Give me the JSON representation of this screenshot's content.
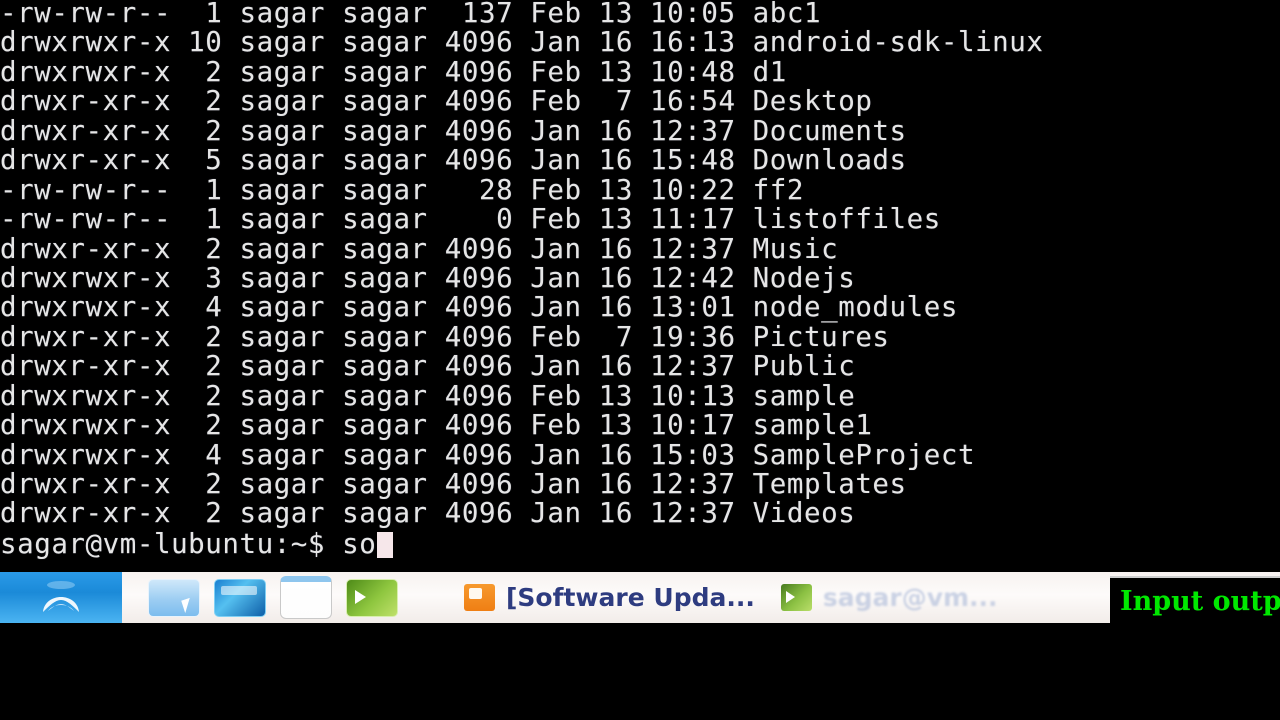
{
  "terminal": {
    "lines": [
      "-rw-rw-r--  1 sagar sagar  137 Feb 13 10:05 abc1",
      "drwxrwxr-x 10 sagar sagar 4096 Jan 16 16:13 android-sdk-linux",
      "drwxrwxr-x  2 sagar sagar 4096 Feb 13 10:48 d1",
      "drwxr-xr-x  2 sagar sagar 4096 Feb  7 16:54 Desktop",
      "drwxr-xr-x  2 sagar sagar 4096 Jan 16 12:37 Documents",
      "drwxr-xr-x  5 sagar sagar 4096 Jan 16 15:48 Downloads",
      "-rw-rw-r--  1 sagar sagar   28 Feb 13 10:22 ff2",
      "-rw-rw-r--  1 sagar sagar    0 Feb 13 11:17 listoffiles",
      "drwxr-xr-x  2 sagar sagar 4096 Jan 16 12:37 Music",
      "drwxrwxr-x  3 sagar sagar 4096 Jan 16 12:42 Nodejs",
      "drwxrwxr-x  4 sagar sagar 4096 Jan 16 13:01 node_modules",
      "drwxr-xr-x  2 sagar sagar 4096 Feb  7 19:36 Pictures",
      "drwxr-xr-x  2 sagar sagar 4096 Jan 16 12:37 Public",
      "drwxrwxr-x  2 sagar sagar 4096 Feb 13 10:13 sample",
      "drwxrwxr-x  2 sagar sagar 4096 Feb 13 10:17 sample1",
      "drwxrwxr-x  4 sagar sagar 4096 Jan 16 15:03 SampleProject",
      "drwxr-xr-x  2 sagar sagar 4096 Jan 16 12:37 Templates",
      "drwxr-xr-x  2 sagar sagar 4096 Jan 16 12:37 Videos"
    ],
    "rows": [
      {
        "permissions": "-rw-rw-r--",
        "links": "1",
        "owner": "sagar",
        "group": "sagar",
        "size": "137",
        "month": "Feb",
        "day": "13",
        "time": "10:05",
        "name": "abc1",
        "type": "file"
      },
      {
        "permissions": "drwxrwxr-x",
        "links": "10",
        "owner": "sagar",
        "group": "sagar",
        "size": "4096",
        "month": "Jan",
        "day": "16",
        "time": "16:13",
        "name": "android-sdk-linux",
        "type": "dir"
      },
      {
        "permissions": "drwxrwxr-x",
        "links": "2",
        "owner": "sagar",
        "group": "sagar",
        "size": "4096",
        "month": "Feb",
        "day": "13",
        "time": "10:48",
        "name": "d1",
        "type": "dir"
      },
      {
        "permissions": "drwxr-xr-x",
        "links": "2",
        "owner": "sagar",
        "group": "sagar",
        "size": "4096",
        "month": "Feb",
        "day": "7",
        "time": "16:54",
        "name": "Desktop",
        "type": "dir"
      },
      {
        "permissions": "drwxr-xr-x",
        "links": "2",
        "owner": "sagar",
        "group": "sagar",
        "size": "4096",
        "month": "Jan",
        "day": "16",
        "time": "12:37",
        "name": "Documents",
        "type": "dir"
      },
      {
        "permissions": "drwxr-xr-x",
        "links": "5",
        "owner": "sagar",
        "group": "sagar",
        "size": "4096",
        "month": "Jan",
        "day": "16",
        "time": "15:48",
        "name": "Downloads",
        "type": "dir"
      },
      {
        "permissions": "-rw-rw-r--",
        "links": "1",
        "owner": "sagar",
        "group": "sagar",
        "size": "28",
        "month": "Feb",
        "day": "13",
        "time": "10:22",
        "name": "ff2",
        "type": "file"
      },
      {
        "permissions": "-rw-rw-r--",
        "links": "1",
        "owner": "sagar",
        "group": "sagar",
        "size": "0",
        "month": "Feb",
        "day": "13",
        "time": "11:17",
        "name": "listoffiles",
        "type": "file"
      },
      {
        "permissions": "drwxr-xr-x",
        "links": "2",
        "owner": "sagar",
        "group": "sagar",
        "size": "4096",
        "month": "Jan",
        "day": "16",
        "time": "12:37",
        "name": "Music",
        "type": "dir"
      },
      {
        "permissions": "drwxrwxr-x",
        "links": "3",
        "owner": "sagar",
        "group": "sagar",
        "size": "4096",
        "month": "Jan",
        "day": "16",
        "time": "12:42",
        "name": "Nodejs",
        "type": "dir"
      },
      {
        "permissions": "drwxrwxr-x",
        "links": "4",
        "owner": "sagar",
        "group": "sagar",
        "size": "4096",
        "month": "Jan",
        "day": "16",
        "time": "13:01",
        "name": "node_modules",
        "type": "dir"
      },
      {
        "permissions": "drwxr-xr-x",
        "links": "2",
        "owner": "sagar",
        "group": "sagar",
        "size": "4096",
        "month": "Feb",
        "day": "7",
        "time": "19:36",
        "name": "Pictures",
        "type": "dir"
      },
      {
        "permissions": "drwxr-xr-x",
        "links": "2",
        "owner": "sagar",
        "group": "sagar",
        "size": "4096",
        "month": "Jan",
        "day": "16",
        "time": "12:37",
        "name": "Public",
        "type": "dir"
      },
      {
        "permissions": "drwxrwxr-x",
        "links": "2",
        "owner": "sagar",
        "group": "sagar",
        "size": "4096",
        "month": "Feb",
        "day": "13",
        "time": "10:13",
        "name": "sample",
        "type": "dir"
      },
      {
        "permissions": "drwxrwxr-x",
        "links": "2",
        "owner": "sagar",
        "group": "sagar",
        "size": "4096",
        "month": "Feb",
        "day": "13",
        "time": "10:17",
        "name": "sample1",
        "type": "dir"
      },
      {
        "permissions": "drwxrwxr-x",
        "links": "4",
        "owner": "sagar",
        "group": "sagar",
        "size": "4096",
        "month": "Jan",
        "day": "16",
        "time": "15:03",
        "name": "SampleProject",
        "type": "dir"
      },
      {
        "permissions": "drwxr-xr-x",
        "links": "2",
        "owner": "sagar",
        "group": "sagar",
        "size": "4096",
        "month": "Jan",
        "day": "16",
        "time": "12:37",
        "name": "Templates",
        "type": "dir"
      },
      {
        "permissions": "drwxr-xr-x",
        "links": "2",
        "owner": "sagar",
        "group": "sagar",
        "size": "4096",
        "month": "Jan",
        "day": "16",
        "time": "12:37",
        "name": "Videos",
        "type": "dir"
      }
    ],
    "prompt": "sagar@vm-lubuntu:~$ ",
    "typed_command": "so",
    "prompt_user": "sagar",
    "prompt_host": "vm-lubuntu",
    "prompt_path": "~",
    "prompt_symbol": "$",
    "text_color": "#e6e6e6",
    "background_color": "#000000",
    "cursor_color": "#f6e7ea"
  },
  "taskbar": {
    "menu_button": {
      "icon": "lubuntu-logo-icon",
      "color": "#1b8ad8"
    },
    "launchers": [
      {
        "icon": "file-manager-icon",
        "label": "File Manager"
      },
      {
        "icon": "web-browser-icon",
        "label": "Web Browser"
      },
      {
        "icon": "text-editor-icon",
        "label": "Text Editor"
      },
      {
        "icon": "terminal-icon",
        "label": "Terminal"
      }
    ],
    "window_buttons": [
      {
        "icon": "software-updater-icon",
        "label": "[Software Upda...",
        "state": "normal"
      },
      {
        "icon": "terminal-icon",
        "label": "sagar@vm...",
        "state": "faded"
      }
    ],
    "background_color": "#f7f2f0",
    "label_color": "#2e3c80"
  },
  "caption_overlay": {
    "text": "Input outpu",
    "color": "#00e800",
    "background_color": "#000000"
  }
}
